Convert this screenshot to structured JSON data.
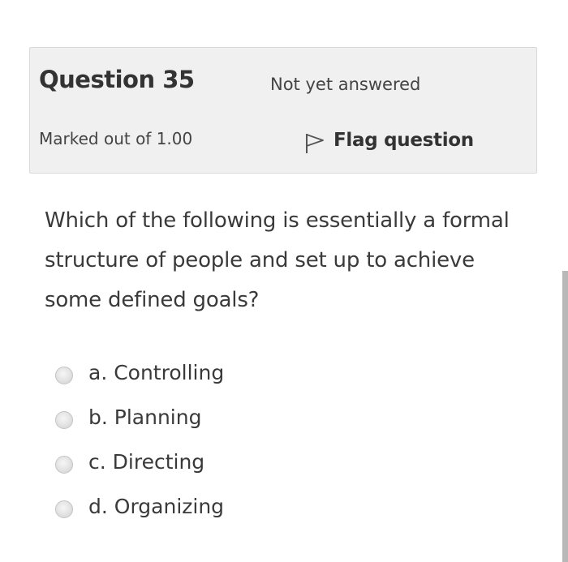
{
  "question": {
    "number_label": "Question 35",
    "state": "Not yet answered",
    "grade": "Marked out of 1.00",
    "flag_label": "Flag question",
    "flag_icon": "flag-icon",
    "text": "Which of the following is essentially a formal structure of people and set up to achieve some defined goals?"
  },
  "answers": [
    {
      "label": "a. Controlling",
      "selected": false
    },
    {
      "label": "b. Planning",
      "selected": false
    },
    {
      "label": "c. Directing",
      "selected": false
    },
    {
      "label": "d. Organizing",
      "selected": false
    }
  ],
  "colors": {
    "info_background": "#f0f0f0",
    "info_border": "#d9d9d9",
    "text": "#333333",
    "scrollbar": "#b8b8b8"
  }
}
